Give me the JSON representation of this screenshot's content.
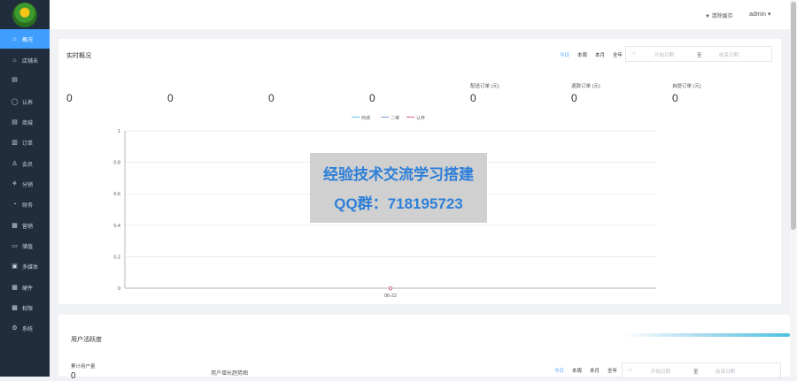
{
  "sidebar": {
    "items": [
      {
        "label": "概况",
        "icon": "home-icon",
        "glyph": "⌂",
        "active": true
      },
      {
        "label": "店铺未",
        "icon": "shop-icon",
        "glyph": "⌂",
        "active": false
      },
      {
        "label": "",
        "icon": "store-icon",
        "glyph": "▤",
        "active": false
      },
      {
        "label": "认养",
        "icon": "adopt-icon",
        "glyph": "◯",
        "active": false
      },
      {
        "label": "商城",
        "icon": "mall-icon",
        "glyph": "▤",
        "active": false
      },
      {
        "label": "订单",
        "icon": "order-icon",
        "glyph": "▥",
        "active": false
      },
      {
        "label": "会员",
        "icon": "member-icon",
        "glyph": "♙",
        "active": false
      },
      {
        "label": "分销",
        "icon": "distribution-icon",
        "glyph": "⚘",
        "active": false
      },
      {
        "label": "财务",
        "icon": "finance-icon",
        "glyph": "◔",
        "active": false
      },
      {
        "label": "营销",
        "icon": "marketing-icon",
        "glyph": "▦",
        "active": false
      },
      {
        "label": "储值",
        "icon": "stored-value-icon",
        "glyph": "▭",
        "active": false
      },
      {
        "label": "多媒体",
        "icon": "media-icon",
        "glyph": "▣",
        "active": false
      },
      {
        "label": "硬件",
        "icon": "hardware-icon",
        "glyph": "▦",
        "active": false
      },
      {
        "label": "权限",
        "icon": "permission-icon",
        "glyph": "▩",
        "active": false
      },
      {
        "label": "系统",
        "icon": "settings-icon",
        "glyph": "⚙",
        "active": false
      }
    ]
  },
  "topbar": {
    "clear_cache": "清除缓存",
    "user": "admin",
    "user_caret": "▾"
  },
  "overview": {
    "title": "实时概况",
    "ranges": [
      "今日",
      "本周",
      "本月",
      "全年"
    ],
    "date_start_placeholder": "开始日期",
    "date_sep": "至",
    "date_end_placeholder": "结束日期",
    "stats": [
      {
        "label": "",
        "value": "0"
      },
      {
        "label": "",
        "value": "0"
      },
      {
        "label": "",
        "value": "0"
      },
      {
        "label": "",
        "value": "0"
      },
      {
        "label": "配送订单 (元)",
        "value": "0"
      },
      {
        "label": "退款订单 (元)",
        "value": "0"
      },
      {
        "label": "自提订单 (元)",
        "value": "0"
      }
    ]
  },
  "chart_data": {
    "type": "line",
    "x": [
      "06-22"
    ],
    "ylim": [
      0,
      1
    ],
    "yticks": [
      "0",
      "0.2",
      "0.4",
      "0.6",
      "0.8",
      "1"
    ],
    "series": [
      {
        "name": "商城",
        "values": [
          0
        ],
        "color": "#55c7e6"
      },
      {
        "name": "二维",
        "values": [
          0
        ],
        "color": "#7d9cd6"
      },
      {
        "name": "认养",
        "values": [
          0
        ],
        "color": "#d9607a"
      }
    ],
    "grid": true,
    "legend": "top-center"
  },
  "activity": {
    "title": "用户活跃度",
    "total_users_label": "累计用户量",
    "total_users_value": "0",
    "growth_title": "用户增长趋势图",
    "ranges": [
      "今日",
      "本周",
      "本月",
      "全年"
    ],
    "date_start_placeholder": "开始日期",
    "date_sep": "至",
    "date_end_placeholder": "结束日期"
  },
  "watermark": {
    "line1": "经验技术交流学习搭建",
    "line2": "QQ群：718195723"
  }
}
